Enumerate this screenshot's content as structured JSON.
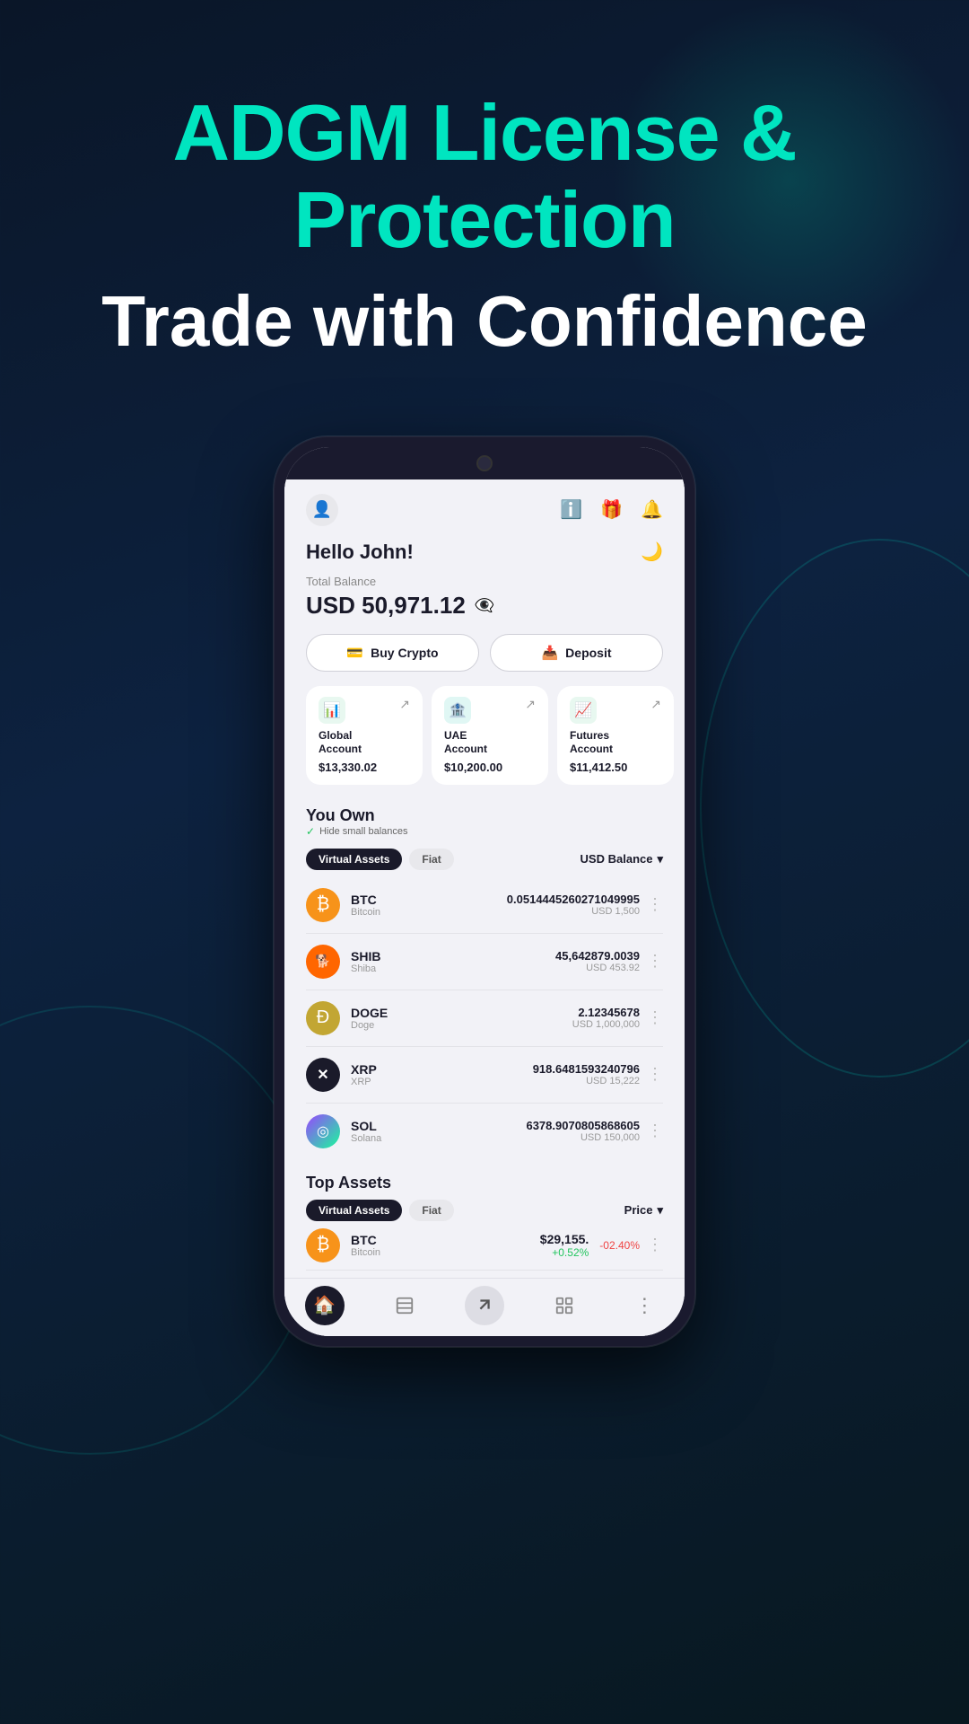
{
  "background": {
    "gradient": "linear-gradient(160deg, #0a1628 0%, #0d2240 40%, #081820 100%)"
  },
  "hero": {
    "title_teal": "ADGM License &",
    "title_teal2": "Protection",
    "title_white": "Trade with Confidence"
  },
  "phone": {
    "topbar": {
      "profile_icon": "👤",
      "info_icon": "ℹ",
      "gift_icon": "🎁",
      "bell_icon": "🔔"
    },
    "greeting": {
      "text": "Hello John!",
      "moon_icon": "🌙"
    },
    "balance": {
      "label": "Total Balance",
      "amount": "USD 50,971.12",
      "hide_icon": "👁‍🗨"
    },
    "actions": {
      "buy_crypto": "Buy Crypto",
      "deposit": "Deposit"
    },
    "accounts": [
      {
        "name": "Global\nAccount",
        "balance": "$13,330.02",
        "icon": "📊",
        "icon_type": "green"
      },
      {
        "name": "UAE\nAccount",
        "balance": "$10,200.00",
        "icon": "🏦",
        "icon_type": "teal"
      },
      {
        "name": "Futures\nAccount",
        "balance": "$11,412.50",
        "icon": "📈",
        "icon_type": "green2"
      }
    ],
    "you_own": {
      "title": "You Own",
      "hide_label": "Hide small balances",
      "filter_active": "Virtual Assets",
      "filter_inactive": "Fiat",
      "balance_filter": "USD Balance"
    },
    "assets": [
      {
        "symbol": "BTC",
        "name": "Bitcoin",
        "amount": "0.0514445260271049995",
        "usd": "USD 1,500",
        "logo_type": "btc",
        "logo_text": "₿"
      },
      {
        "symbol": "SHIB",
        "name": "Shiba",
        "amount": "45,642879.0039",
        "usd": "USD 453.92",
        "logo_type": "shib",
        "logo_text": "🐕"
      },
      {
        "symbol": "DOGE",
        "name": "Doge",
        "amount": "2.12345678",
        "usd": "USD 1,000,000",
        "logo_type": "doge",
        "logo_text": "Ð"
      },
      {
        "symbol": "XRP",
        "name": "XRP",
        "amount": "918.6481593240796",
        "usd": "USD 15,222",
        "logo_type": "xrp",
        "logo_text": "✕"
      },
      {
        "symbol": "SOL",
        "name": "Solana",
        "amount": "6378.9070805868605",
        "usd": "USD 150,000",
        "logo_type": "sol",
        "logo_text": "◎"
      }
    ],
    "top_assets": {
      "title": "Top Assets",
      "filter_active": "Virtual Assets",
      "filter_inactive": "Fiat",
      "price_filter": "Price"
    },
    "top_asset_preview": {
      "symbol": "BTC",
      "price": "$29,155.",
      "change_pos": "+0.52%",
      "change_neg": "-02.40%"
    },
    "bottom_nav": [
      {
        "icon": "🏠",
        "type": "active"
      },
      {
        "icon": "≡",
        "type": "inactive"
      },
      {
        "icon": "⬆⬇",
        "type": "highlight"
      },
      {
        "icon": "⊞",
        "type": "inactive"
      },
      {
        "icon": "⋮",
        "type": "inactive"
      }
    ]
  }
}
